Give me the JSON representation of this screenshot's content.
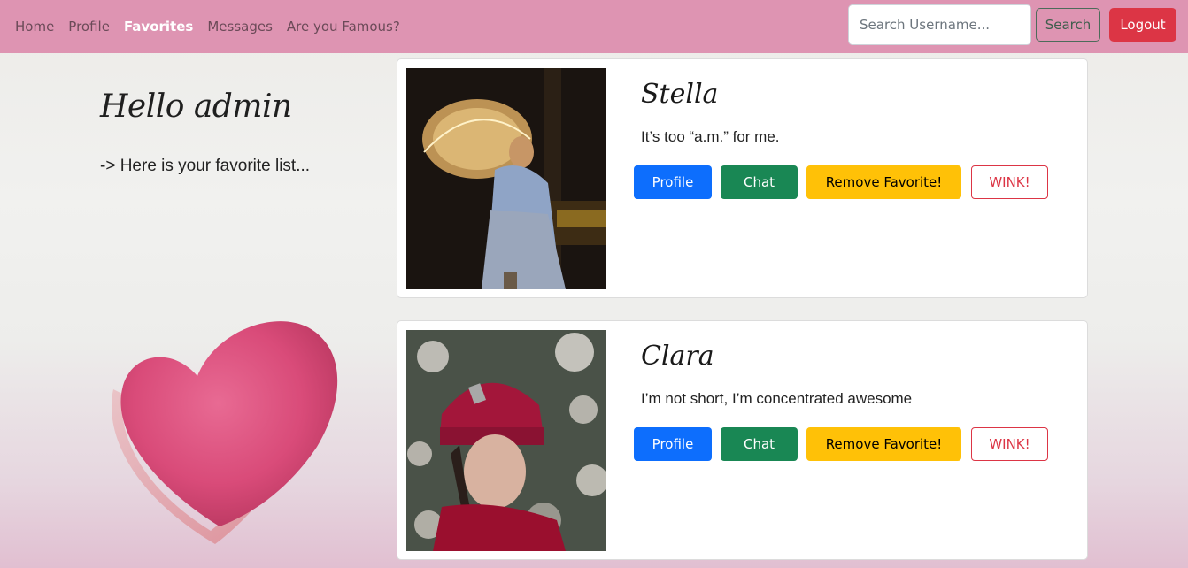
{
  "nav": {
    "links": [
      {
        "label": "Home"
      },
      {
        "label": "Profile"
      },
      {
        "label": "Favorites"
      },
      {
        "label": "Messages"
      },
      {
        "label": "Are you Famous?"
      }
    ],
    "search_placeholder": "Search Username...",
    "search_label": "Search",
    "logout_label": "Logout"
  },
  "greeting": {
    "title": "Hello admin",
    "subtitle": "-> Here is your favorite list..."
  },
  "favorites": [
    {
      "name": "Stella",
      "bio": "It’s too “a.m.” for me.",
      "buttons": {
        "profile": "Profile",
        "chat": "Chat",
        "remove": "Remove Favorite!",
        "wink": "WINK!"
      }
    },
    {
      "name": "Clara",
      "bio": "I’m not short, I’m concentrated awesome",
      "buttons": {
        "profile": "Profile",
        "chat": "Chat",
        "remove": "Remove Favorite!",
        "wink": "WINK!"
      }
    }
  ],
  "colors": {
    "navbar": "#de94b2",
    "primary": "#0d6efd",
    "success": "#198754",
    "warning": "#ffc107",
    "danger": "#dc3545"
  }
}
